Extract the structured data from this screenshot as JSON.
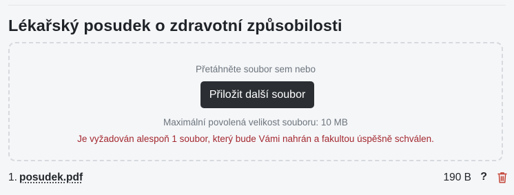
{
  "title": "Lékařský posudek o zdravotní způsobilosti",
  "dropzone": {
    "hint": "Přetáhněte soubor sem nebo",
    "button_label": "Přiložit další soubor",
    "max_size": "Maximální povolená velikost souboru: 10 MB",
    "error": "Je vyžadován alespoň 1 soubor, který bude Vámi nahrán a fakultou úspěšně schválen."
  },
  "files": [
    {
      "index": "1.",
      "name": "posudek.pdf",
      "size": "190 B",
      "help": "?",
      "delete_icon": "trash-icon"
    }
  ],
  "colors": {
    "button": "#2b2f33",
    "error": "#a3282f",
    "trash": "#c0392b"
  }
}
